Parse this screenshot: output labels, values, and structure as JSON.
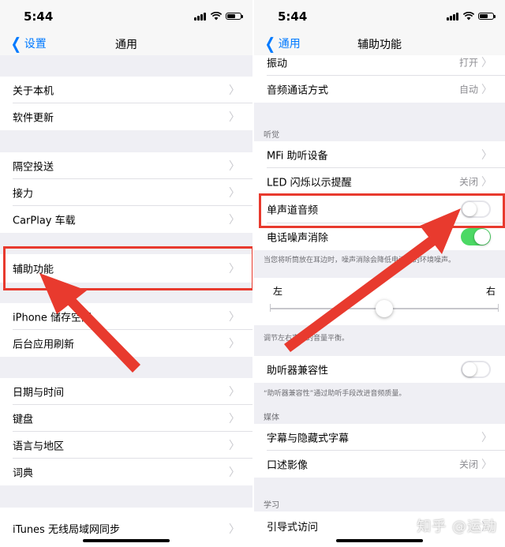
{
  "left": {
    "time": "5:44",
    "back": "设置",
    "title": "通用",
    "items": [
      {
        "label": "关于本机"
      },
      {
        "label": "软件更新"
      },
      {
        "label": "隔空投送"
      },
      {
        "label": "接力"
      },
      {
        "label": "CarPlay 车载"
      },
      {
        "label": "辅助功能"
      },
      {
        "label": "iPhone 储存空间"
      },
      {
        "label": "后台应用刷新"
      },
      {
        "label": "日期与时间"
      },
      {
        "label": "键盘"
      },
      {
        "label": "语言与地区"
      },
      {
        "label": "词典"
      },
      {
        "label": "iTunes 无线局域网同步"
      }
    ]
  },
  "right": {
    "time": "5:44",
    "back": "通用",
    "title": "辅助功能",
    "vibration": {
      "label": "振动",
      "value": "打开"
    },
    "call_audio": {
      "label": "音频通话方式",
      "value": "自动"
    },
    "hearing_header": "听觉",
    "mfi": {
      "label": "MFi 助听设备"
    },
    "led": {
      "label": "LED 闪烁以示提醒",
      "value": "关闭"
    },
    "mono": {
      "label": "单声道音频",
      "on": false
    },
    "noise": {
      "label": "电话噪声消除",
      "on": true
    },
    "noise_note": "当您将听筒放在耳边时，噪声消除会降低电话中的环境噪声。",
    "balance": {
      "left": "左",
      "right": "右",
      "position": 0.5
    },
    "balance_note": "调节左右声道的音量平衡。",
    "hac": {
      "label": "助听器兼容性",
      "on": false
    },
    "hac_note": "“助听器兼容性”通过助听手段改进音频质量。",
    "media_header": "媒体",
    "subtitles": {
      "label": "字幕与隐藏式字幕"
    },
    "audio_desc": {
      "label": "口述影像",
      "value": "关闭"
    },
    "learning_header": "学习",
    "guided": {
      "label": "引导式访问"
    }
  },
  "watermark": "知乎 @运动",
  "colors": {
    "accent": "#007aff",
    "highlight": "#e83a2e",
    "toggle_on": "#4cd964"
  }
}
